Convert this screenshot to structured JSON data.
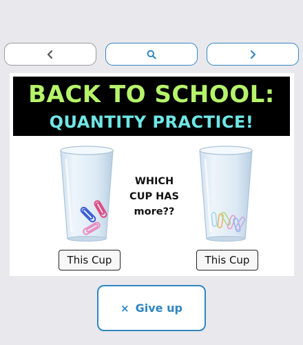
{
  "nav": {
    "prev_icon": "chevron-left-icon",
    "search_icon": "search-icon",
    "next_icon": "chevron-right-icon"
  },
  "banner": {
    "line1": "BACK TO SCHOOL:",
    "line2": "QUANTITY PRACTICE!"
  },
  "question": "WHICH\nCUP HAS\nmore??",
  "cups": {
    "left_button": "This Cup",
    "right_button": "This Cup"
  },
  "give_up": {
    "icon": "×",
    "label": "Give up"
  },
  "colors": {
    "accent": "#2f86c1",
    "banner_bg": "#000000",
    "banner_line1": "#b6f36b",
    "banner_line2": "#6fe6e6",
    "page_bg": "#e9e8ed"
  }
}
